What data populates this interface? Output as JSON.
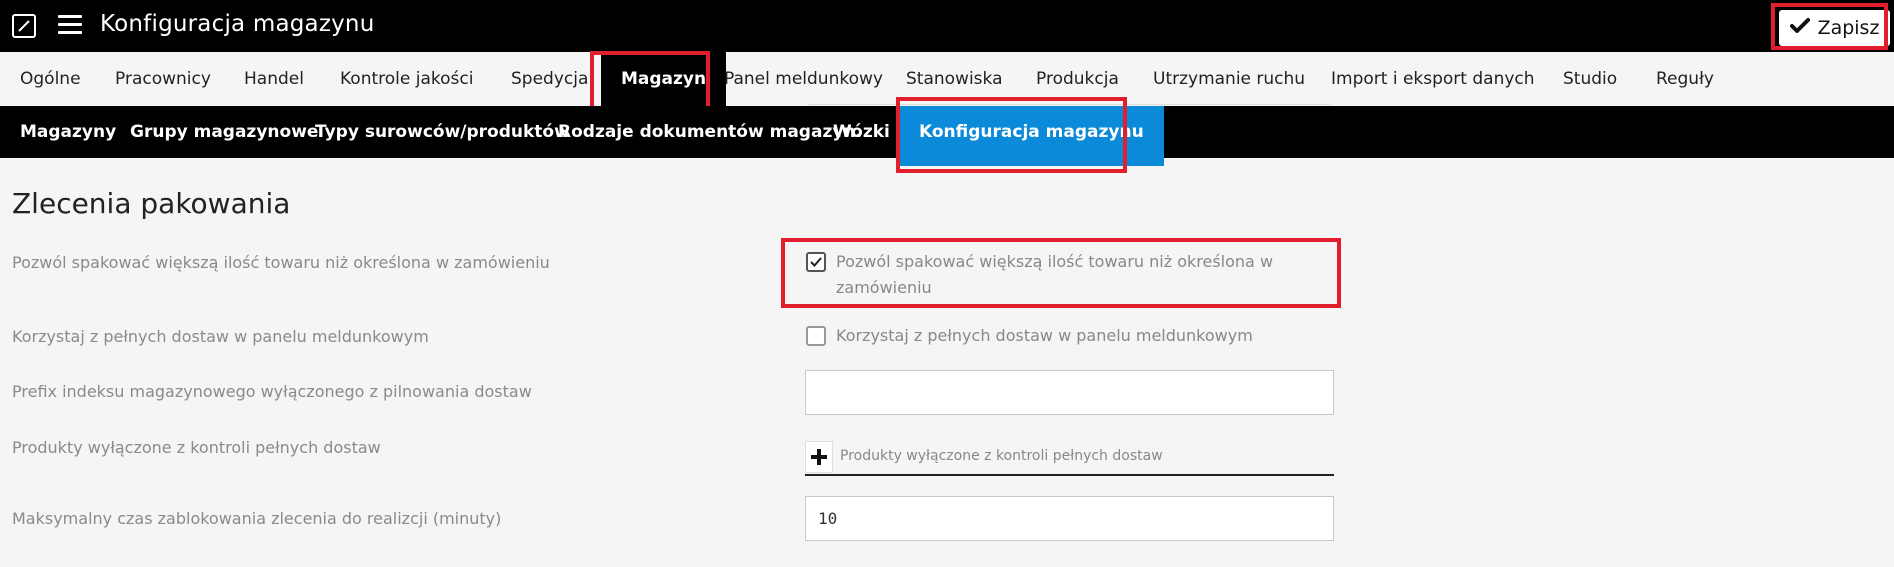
{
  "header": {
    "title": "Konfiguracja magazynu",
    "save_label": "Zapisz",
    "logo_icon": "brand-logo-icon",
    "menu_icon": "hamburger-menu-icon"
  },
  "main_tabs": [
    {
      "label": "Ogólne"
    },
    {
      "label": "Pracownicy"
    },
    {
      "label": "Handel"
    },
    {
      "label": "Kontrole jakości"
    },
    {
      "label": "Spedycja"
    },
    {
      "label": "Magazyn",
      "active": true
    },
    {
      "label": "Panel meldunkowy"
    },
    {
      "label": "Stanowiska"
    },
    {
      "label": "Produkcja"
    },
    {
      "label": "Utrzymanie ruchu"
    },
    {
      "label": "Import i eksport danych"
    },
    {
      "label": "Studio"
    },
    {
      "label": "Reguły"
    }
  ],
  "sub_tabs": [
    {
      "label": "Magazyny"
    },
    {
      "label": "Grupy magazynowe"
    },
    {
      "label": "Typy surowców/produktów"
    },
    {
      "label": "Rodzaje dokumentów magazyn."
    },
    {
      "label": "Wózki"
    },
    {
      "label": "Konfiguracja magazynu",
      "active": true
    }
  ],
  "section": {
    "title": "Zlecenia pakowania",
    "fields": [
      {
        "label": "Pozwól spakować większą ilość towaru niż określona w zamówieniu",
        "type": "checkbox",
        "checked": true,
        "checkbox_label_line1": "Pozwól spakować większą ilość towaru niż określona w",
        "checkbox_label_line2": "zamówieniu"
      },
      {
        "label": "Korzystaj z pełnych dostaw w panelu meldunkowym",
        "type": "checkbox",
        "checked": false,
        "checkbox_label_line1": "Korzystaj z pełnych dostaw w panelu meldunkowym"
      },
      {
        "label": "Prefix indeksu magazynowego wyłączonego z pilnowania dostaw",
        "type": "text",
        "value": ""
      },
      {
        "label": "Produkty wyłączone z kontroli pełnych dostaw",
        "type": "multiselect",
        "placeholder": "Produkty wyłączone z kontroli pełnych dostaw"
      },
      {
        "label": "Maksymalny czas zablokowania zlecenia do realizcji (minuty)",
        "type": "text",
        "value": "10"
      }
    ]
  },
  "colors": {
    "highlight": "#e01e2e",
    "active_subtab": "#0a8ad8",
    "bar": "#000000"
  }
}
